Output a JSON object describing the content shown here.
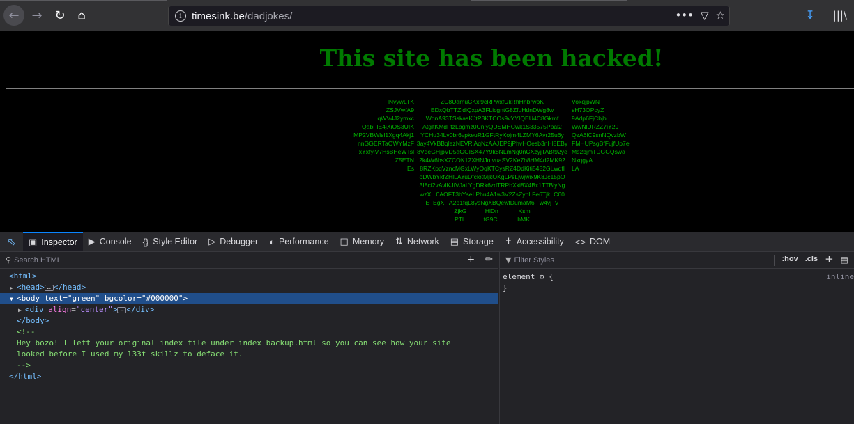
{
  "browser": {
    "url_host": "timesink.be",
    "url_path": "/dadjokes/",
    "icons": [
      "back-arrow-icon",
      "forward-arrow-icon",
      "reload-icon",
      "home-icon",
      "info-icon",
      "more-icon",
      "pocket-icon",
      "bookmark-star-icon",
      "download-icon",
      "library-icon"
    ]
  },
  "page": {
    "heading": "This site has been hacked!",
    "art_left": "lNvywLTK\nZSJVwfA9\nqWV4J2ymxc\nQabFlE4jXiOS3UIK\nMP2VBWlsl1Xgq4Akj1\nnnGGERTaOWYMzF\nxYxfyiV7HsBHeWTsl\nZ5ETN\nEs",
    "art_center": "ZC8UamuCKxl9cRPwxfUkRhHhbrwoK\nEDxQbTTZidiQxpA3FLicgntG8ZfuHdnDWg8w\nWqnA93TSskasKJtP3KTCOs9vYYIQEU4C8Gkmf\nAtgltKMdFtzLbgmz0UnlyQDSMHCwk1S33575Ppal2\nYCHu34Lv0br6vpkeuR1GFtRyXojm4LZMY6Avr25u6y\n3ay4VkBBqlezNEVRiAqNzAAJEP9jPhvHOesb3nHl8EBy\n8VqeGHjpVD5aGGISX47Y9k8NLmNg0nCXzyjTABt92ye\n2k4W6bsXZCOK12XHNJotvuaSV2Ke7b8HM4d2MK92\n8RZKpqVzncMGxLWyOqKTCysRZ4DdKiti5452GLwdfl\noDWbYkfZHlLAYuDfclotMjkOKgLPsLjwjwix9K8Jc15pO\n3I8ci2vAvlKJfVJaLYgDRk6zdTRPbXki8X4Bx1TTBiyNg\nwzX   0AOFT3bYseLPhu4A1w3V2ZsZyhLFe6Tjk  C60\nE  EgX   A2p1fqL8ysNgXBQewfDumaM6   w4vj  V\nZjkG           HlDn            Ksm\nPTl            fG9C            hMK",
    "art_right": "VokqjpWN\nsH73OPcyZ\n9Adp6FjCbjb\nWwNlURZZ7iY29\nQzA6lC9snNQvzbW\nFMHUPsgBfFujfUp7e\nMs2bjmTDGGQswa\nNxqgyA\nLA"
  },
  "devtools": {
    "tabs": [
      {
        "label": "Inspector",
        "icon": "inspector-icon"
      },
      {
        "label": "Console",
        "icon": "console-icon"
      },
      {
        "label": "Style Editor",
        "icon": "style-editor-icon"
      },
      {
        "label": "Debugger",
        "icon": "debugger-icon"
      },
      {
        "label": "Performance",
        "icon": "performance-icon"
      },
      {
        "label": "Memory",
        "icon": "memory-icon"
      },
      {
        "label": "Network",
        "icon": "network-icon"
      },
      {
        "label": "Storage",
        "icon": "storage-icon"
      },
      {
        "label": "Accessibility",
        "icon": "accessibility-icon"
      },
      {
        "label": "DOM",
        "icon": "dom-icon"
      }
    ],
    "search_placeholder": "Search HTML",
    "filter_placeholder": "Filter Styles",
    "hov_label": ":hov",
    "cls_label": ".cls",
    "rule_selector": "element",
    "rule_open": "{",
    "rule_close": "}",
    "rule_source": "inline",
    "markup": {
      "html_open": "<html>",
      "head": "<head>",
      "head_close": "</head>",
      "body_tag": "<body",
      "body_attr1_name": "text",
      "body_attr1_val": "\"green\"",
      "body_attr2_name": "bgcolor",
      "body_attr2_val": "\"#000000\"",
      "body_end": ">",
      "div_tag": "<div",
      "div_attr_name": "align",
      "div_attr_val": "\"center\"",
      "div_end": ">",
      "div_close": "</div>",
      "body_close": "</body>",
      "comment_open": "<!--",
      "comment_line1": "Hey bozo! I left your original index file under index_backup.html so you can see how your site",
      "comment_line2": "looked before I used my l33t skillz to deface it.",
      "comment_close": "-->",
      "html_close": "</html>"
    }
  }
}
